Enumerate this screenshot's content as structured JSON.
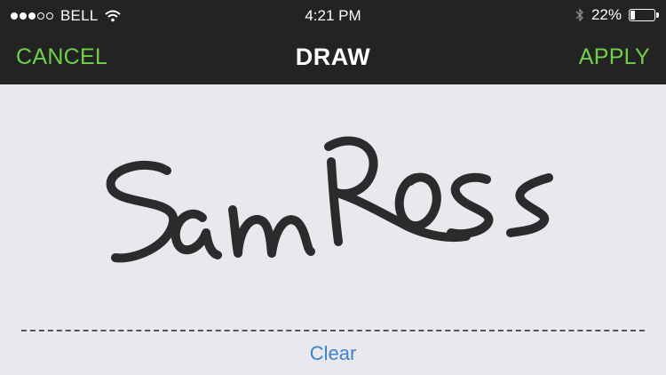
{
  "status_bar": {
    "carrier": "BELL",
    "time": "4:21 PM",
    "battery": "22%",
    "battery_level": 0.22,
    "signal_bars_filled": 3,
    "signal_bars_total": 5
  },
  "nav": {
    "cancel_label": "CANCEL",
    "title": "DRAW",
    "apply_label": "APPLY"
  },
  "canvas": {
    "clear_label": "Clear"
  },
  "colors": {
    "accent_green": "#6fd14a",
    "link_blue": "#3f82c9",
    "bar_bg": "#232323",
    "canvas_bg": "#e9e8ef",
    "ink": "#2b2b2b"
  },
  "icons": [
    "wifi-icon",
    "bluetooth-icon",
    "battery-icon"
  ]
}
